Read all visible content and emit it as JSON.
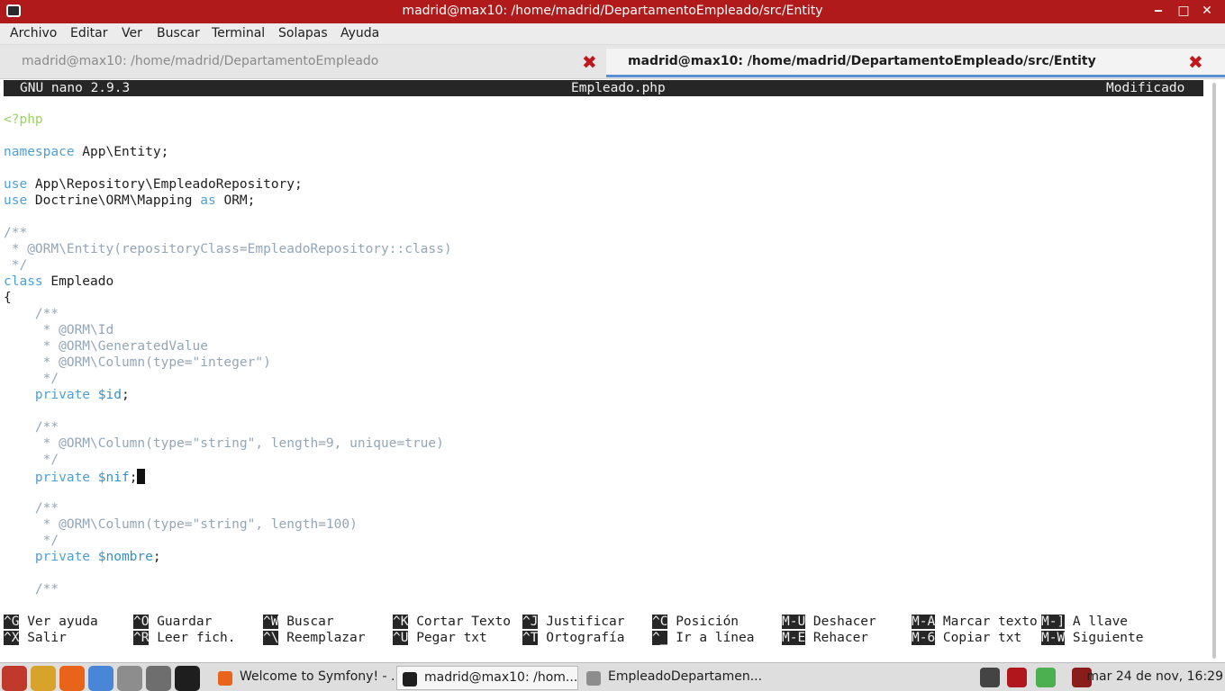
{
  "window": {
    "title": "madrid@max10: /home/madrid/DepartamentoEmpleado/src/Entity",
    "minimize": "‒",
    "maximize": "□",
    "close": "✕"
  },
  "menu": [
    "Archivo",
    "Editar",
    "Ver",
    "Buscar",
    "Terminal",
    "Solapas",
    "Ayuda"
  ],
  "tabs": [
    {
      "label": "madrid@max10: /home/madrid/DepartamentoEmpleado",
      "active": false
    },
    {
      "label": "madrid@max10: /home/madrid/DepartamentoEmpleado/src/Entity",
      "active": true
    }
  ],
  "tab_close": "✖",
  "nano": {
    "version": "GNU nano 2.9.3",
    "filename": "Empleado.php",
    "status": "Modificado"
  },
  "code": [
    {
      "line": 1,
      "segments": [
        {
          "t": "<?php",
          "c": "php"
        }
      ]
    },
    {
      "line": 2,
      "segments": []
    },
    {
      "line": 3,
      "segments": [
        {
          "t": "namespace",
          "c": "kw"
        },
        {
          "t": " App\\Entity;",
          "c": ""
        }
      ]
    },
    {
      "line": 4,
      "segments": []
    },
    {
      "line": 5,
      "segments": [
        {
          "t": "use",
          "c": "kw"
        },
        {
          "t": " App\\Repository\\EmpleadoRepository;",
          "c": ""
        }
      ]
    },
    {
      "line": 6,
      "segments": [
        {
          "t": "use",
          "c": "kw"
        },
        {
          "t": " Doctrine\\ORM\\Mapping ",
          "c": ""
        },
        {
          "t": "as",
          "c": "kw"
        },
        {
          "t": " ORM;",
          "c": ""
        }
      ]
    },
    {
      "line": 7,
      "segments": []
    },
    {
      "line": 8,
      "segments": [
        {
          "t": "/**",
          "c": "cm"
        }
      ]
    },
    {
      "line": 9,
      "segments": [
        {
          "t": " * @ORM\\Entity(repositoryClass=EmpleadoRepository::class)",
          "c": "cm"
        }
      ]
    },
    {
      "line": 10,
      "segments": [
        {
          "t": " */",
          "c": "cm"
        }
      ]
    },
    {
      "line": 11,
      "segments": [
        {
          "t": "class",
          "c": "kw"
        },
        {
          "t": " Empleado",
          "c": ""
        }
      ]
    },
    {
      "line": 12,
      "segments": [
        {
          "t": "{",
          "c": ""
        }
      ]
    },
    {
      "line": 13,
      "segments": [
        {
          "t": "    /**",
          "c": "cm"
        }
      ]
    },
    {
      "line": 14,
      "segments": [
        {
          "t": "     * @ORM\\Id",
          "c": "cm"
        }
      ]
    },
    {
      "line": 15,
      "segments": [
        {
          "t": "     * @ORM\\GeneratedValue",
          "c": "cm"
        }
      ]
    },
    {
      "line": 16,
      "segments": [
        {
          "t": "     * @ORM\\Column(type=\"integer\")",
          "c": "cm"
        }
      ]
    },
    {
      "line": 17,
      "segments": [
        {
          "t": "     */",
          "c": "cm"
        }
      ]
    },
    {
      "line": 18,
      "segments": [
        {
          "t": "    private ",
          "c": "kw"
        },
        {
          "t": "$id",
          "c": "vr"
        },
        {
          "t": ";",
          "c": ""
        }
      ]
    },
    {
      "line": 19,
      "segments": []
    },
    {
      "line": 20,
      "segments": [
        {
          "t": "    /**",
          "c": "cm"
        }
      ]
    },
    {
      "line": 21,
      "segments": [
        {
          "t": "     * @ORM\\Column(type=\"string\", length=9, unique=true)",
          "c": "cm"
        }
      ]
    },
    {
      "line": 22,
      "segments": [
        {
          "t": "     */",
          "c": "cm"
        }
      ]
    },
    {
      "line": 23,
      "segments": [
        {
          "t": "    private ",
          "c": "kw"
        },
        {
          "t": "$nif",
          "c": "vr"
        },
        {
          "t": ";",
          "c": ""
        }
      ],
      "cursor": true
    },
    {
      "line": 24,
      "segments": []
    },
    {
      "line": 25,
      "segments": [
        {
          "t": "    /**",
          "c": "cm"
        }
      ]
    },
    {
      "line": 26,
      "segments": [
        {
          "t": "     * @ORM\\Column(type=\"string\", length=100)",
          "c": "cm"
        }
      ]
    },
    {
      "line": 27,
      "segments": [
        {
          "t": "     */",
          "c": "cm"
        }
      ]
    },
    {
      "line": 28,
      "segments": [
        {
          "t": "    private ",
          "c": "kw"
        },
        {
          "t": "$nombre",
          "c": "vr"
        },
        {
          "t": ";",
          "c": ""
        }
      ]
    },
    {
      "line": 29,
      "segments": []
    },
    {
      "line": 30,
      "segments": [
        {
          "t": "    /**",
          "c": "cm"
        }
      ]
    }
  ],
  "shortcuts_row1": [
    {
      "key": "^G",
      "label": "Ver ayuda"
    },
    {
      "key": "^O",
      "label": "Guardar"
    },
    {
      "key": "^W",
      "label": "Buscar"
    },
    {
      "key": "^K",
      "label": "Cortar Texto"
    },
    {
      "key": "^J",
      "label": "Justificar"
    },
    {
      "key": "^C",
      "label": "Posición"
    },
    {
      "key": "M-U",
      "label": "Deshacer"
    },
    {
      "key": "M-A",
      "label": "Marcar texto"
    },
    {
      "key": "M-]",
      "label": "A llave"
    }
  ],
  "shortcuts_row2": [
    {
      "key": "^X",
      "label": "Salir"
    },
    {
      "key": "^R",
      "label": "Leer fich."
    },
    {
      "key": "^\\",
      "label": "Reemplazar"
    },
    {
      "key": "^U",
      "label": "Pegar txt"
    },
    {
      "key": "^T",
      "label": "Ortografía"
    },
    {
      "key": "^_",
      "label": "Ir a línea"
    },
    {
      "key": "M-E",
      "label": "Rehacer"
    },
    {
      "key": "M-6",
      "label": "Copiar txt"
    },
    {
      "key": "M-W",
      "label": "Siguiente"
    }
  ],
  "taskbar": {
    "launchers": [
      {
        "name": "system-menu-icon",
        "color": "#c0392b"
      },
      {
        "name": "text-editor-icon",
        "color": "#d8a32b"
      },
      {
        "name": "firefox-icon",
        "color": "#e8641b"
      },
      {
        "name": "chromium-icon",
        "color": "#4a86d8"
      },
      {
        "name": "notes-icon",
        "color": "#8d8d8d"
      },
      {
        "name": "screenshot-icon",
        "color": "#6e6e6e"
      },
      {
        "name": "terminal-icon",
        "color": "#1e1e1e"
      }
    ],
    "tasks": [
      {
        "label": "Welcome to Symfony! - ...",
        "icon": "firefox-icon",
        "color": "#e8641b",
        "active": false
      },
      {
        "label": "madrid@max10: /hom...",
        "icon": "terminal-icon",
        "color": "#1e1e1e",
        "active": true
      },
      {
        "label": "EmpleadoDepartamen...",
        "icon": "window-icon",
        "color": "#8d8d8d",
        "active": false
      }
    ],
    "tray": [
      {
        "name": "network-icon",
        "color": "#444444"
      },
      {
        "name": "record-icon",
        "color": "#b0161c"
      },
      {
        "name": "battery-icon",
        "color": "#4caf50"
      },
      {
        "name": "volume-icon",
        "color": "#8a1c1c"
      }
    ],
    "clock": "mar 24 de nov, 16:29"
  }
}
